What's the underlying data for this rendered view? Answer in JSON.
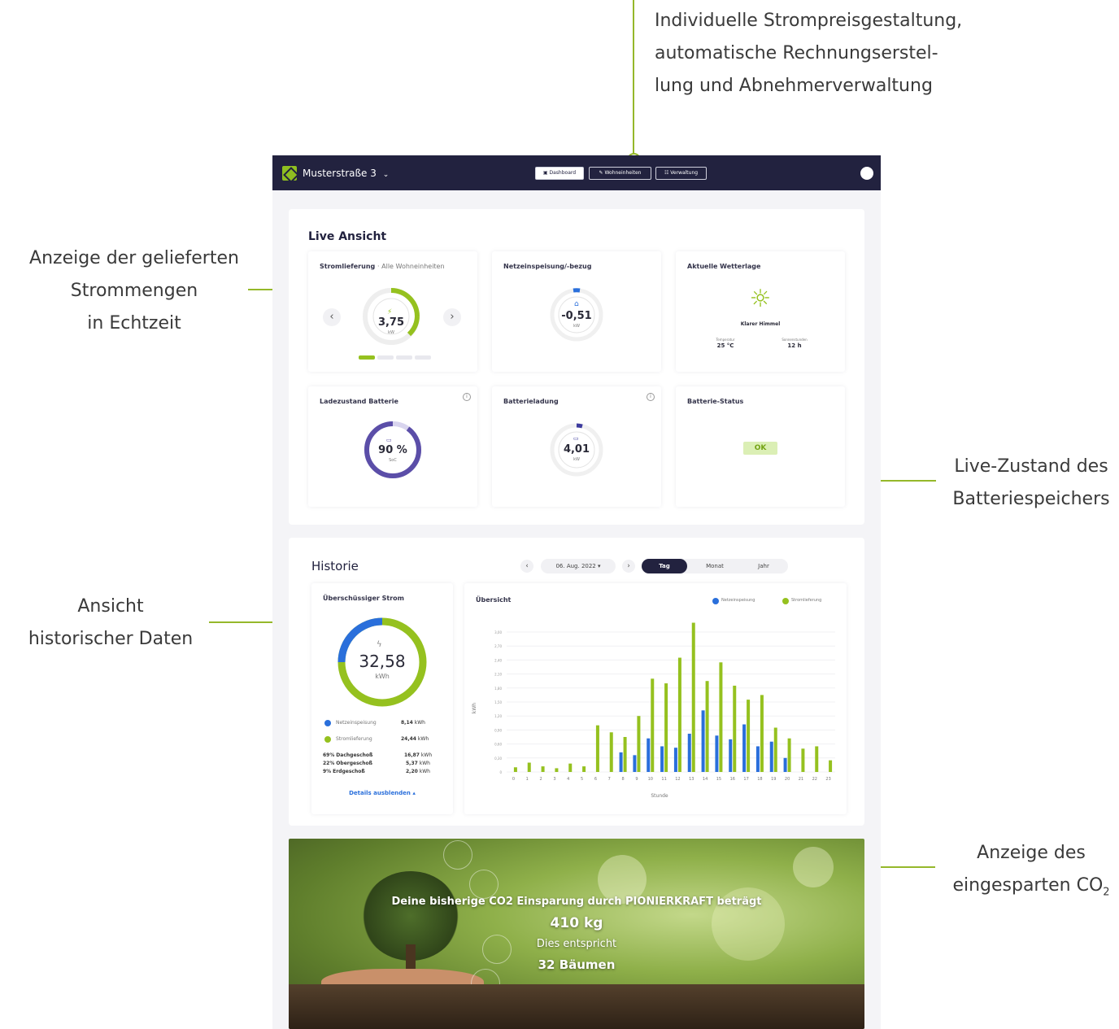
{
  "annotations": {
    "top": [
      "Individuelle Strompreisgestaltung,",
      "automatische Rechnungserstel-",
      "lung und Abnehmerverwaltung"
    ],
    "left1": [
      "Anzeige der gelieferten",
      "Strommengen",
      "in Echtzeit"
    ],
    "left2": [
      "Ansicht",
      "historischer Daten"
    ],
    "right1": [
      "Live-Zustand des",
      "Batteriespeichers"
    ],
    "right2_line1": "Anzeige des",
    "right2_line2": "eingesparten CO",
    "right2_sub": "2"
  },
  "topbar": {
    "site": "Musterstraße 3",
    "nav": [
      "Dashboard",
      "Wohneinheiten",
      "Verwaltung"
    ]
  },
  "live": {
    "title": "Live Ansicht",
    "stromlieferung": {
      "title": "Stromlieferung",
      "subtitle": "· Alle Wohneinheiten",
      "value": "3,75",
      "unit": "kW"
    },
    "netz": {
      "title": "Netzeinspeisung/-bezug",
      "value": "-0,51",
      "unit": "kW"
    },
    "wetter": {
      "title": "Aktuelle Wetterlage",
      "state": "Klarer Himmel",
      "temp_label": "Temperatur",
      "temp_value": "25 °C",
      "sun_label": "Sonnenstunden",
      "sun_value": "12 h"
    },
    "ladezustand": {
      "title": "Ladezustand Batterie",
      "value": "90 %",
      "unit": "SoC",
      "percent": 0.9
    },
    "batterieladung": {
      "title": "Batterieladung",
      "value": "4,01",
      "unit": "kW"
    },
    "status": {
      "title": "Batterie-Status",
      "value": "OK"
    }
  },
  "historie": {
    "title": "Historie",
    "date": "06. Aug. 2022",
    "tabs": [
      "Tag",
      "Monat",
      "Jahr"
    ],
    "surplus": {
      "title": "Überschüssiger Strom",
      "value": "32,58",
      "unit": "kWh",
      "rows": [
        {
          "label": "Netzeinspeisung",
          "value": "8,14",
          "unit": "kWh"
        },
        {
          "label": "Stromlieferung",
          "value": "24,44",
          "unit": "kWh"
        }
      ],
      "details": [
        {
          "pct": "69%",
          "label": "Dachgeschoß",
          "value": "16,87",
          "unit": "kWh"
        },
        {
          "pct": "22%",
          "label": "Obergeschoß",
          "value": "5,37",
          "unit": "kWh"
        },
        {
          "pct": "9%",
          "label": "Erdgeschoß",
          "value": "2,20",
          "unit": "kWh"
        }
      ],
      "toggle": "Details ausblenden"
    }
  },
  "chart_data": {
    "type": "bar",
    "title": "Übersicht",
    "xlabel": "Stunde",
    "ylabel": "kWh",
    "categories": [
      "0",
      "1",
      "2",
      "3",
      "4",
      "5",
      "6",
      "7",
      "8",
      "9",
      "10",
      "11",
      "12",
      "13",
      "14",
      "15",
      "16",
      "17",
      "18",
      "19",
      "20",
      "21",
      "22",
      "23"
    ],
    "yticks": [
      "0",
      "0,30",
      "0,60",
      "0,90",
      "1,20",
      "1,50",
      "1,80",
      "2,10",
      "2,40",
      "2,70",
      "3,00"
    ],
    "ylim": [
      0,
      3.0
    ],
    "legend_position": "top-right",
    "series": [
      {
        "name": "Netzeinspeisung",
        "color": "#2a6fdb",
        "values": [
          0,
          0,
          0,
          0,
          0,
          0,
          0,
          0,
          0.42,
          0.36,
          0.72,
          0.55,
          0.52,
          0.82,
          1.32,
          0.78,
          0.7,
          1.02,
          0.55,
          0.65,
          0.3,
          0,
          0,
          0
        ]
      },
      {
        "name": "Stromlieferung",
        "color": "#95c11f",
        "values": [
          0.1,
          0.2,
          0.12,
          0.08,
          0.18,
          0.12,
          1.0,
          0.85,
          0.75,
          1.2,
          2.0,
          1.9,
          2.45,
          3.2,
          1.95,
          2.35,
          1.85,
          1.55,
          1.65,
          0.95,
          0.72,
          0.5,
          0.55,
          0.25
        ]
      }
    ]
  },
  "co2": {
    "line1": "Deine bisherige CO2 Einsparung durch PIONIERKRAFT beträgt",
    "value": "410 kg",
    "line3": "Dies entspricht",
    "trees": "32 Bäumen"
  }
}
